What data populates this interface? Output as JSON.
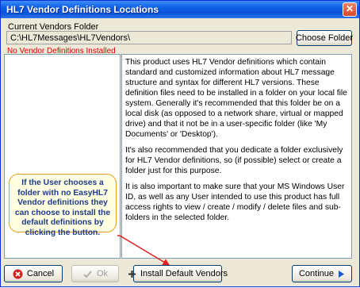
{
  "window": {
    "title": "HL7 Vendor Definitions Locations",
    "close_glyph": "✕"
  },
  "folder": {
    "label": "Current Vendors Folder",
    "value": "C:\\HL7Messages\\HL7Vendors\\",
    "choose_button": "Choose Folder"
  },
  "status": {
    "message": "No Vendor Definitions Installed",
    "color": "#e00000"
  },
  "info": {
    "paragraphs": [
      "This product uses HL7 Vendor definitions which contain standard and customized information about HL7 message structure and syntax for different HL7 versions. These definition files need to be installed in a folder on your local file system. Generally it's recommended that this folder be on a local disk (as opposed to a network share, virtual or mapped drive) and that it not be in a user-specific folder (like 'My Documents' or 'Desktop').",
      "It's also recommended that you dedicate a folder exclusively for HL7 Vendor definitions, so (if possible) select or create a folder just for this purpose.",
      "It is also important to make sure that your MS Windows User ID, as well as any User intended to use  this product has full access rights to view / create / modify / delete files and sub-folders in the selected folder."
    ]
  },
  "callout": {
    "text": "If the User chooses a folder with no EasyHL7 Vendor definitions they can choose to install the default definitions by clicking the button."
  },
  "buttons": {
    "cancel": "Cancel",
    "ok": "Ok",
    "install": "Install Default Vendors",
    "continue": "Continue"
  },
  "icons": {
    "cancel": "x-icon",
    "ok": "checkmark-icon",
    "install": "plus-icon",
    "continue": "arrow-right-icon"
  },
  "colors": {
    "titlebar": "#0a53d8",
    "callout_border": "#e0a020",
    "callout_text": "#1f3a8a",
    "arrow": "#e02020"
  }
}
